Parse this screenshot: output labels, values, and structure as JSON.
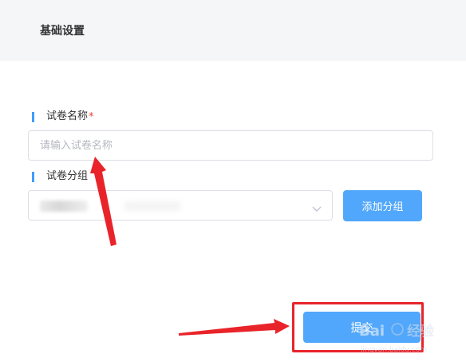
{
  "header": {
    "title": "基础设置"
  },
  "form": {
    "name_label": "试卷名称",
    "name_required_mark": "*",
    "name_placeholder": "请输入试卷名称",
    "name_value": "",
    "group_label": "试卷分组",
    "group_selected": "",
    "add_group_button": "添加分组",
    "submit_button": "提交"
  },
  "colors": {
    "accent": "#409eff",
    "button_bg": "#51a7fb",
    "header_bg": "#f5f6f8",
    "annotation_red": "#e8242a",
    "required": "#e8433a"
  },
  "icons": {
    "select_arrow": "chevron-down-icon"
  },
  "watermark": {
    "text": "Bai 经验",
    "subtext": "jingyan.baidu.com"
  }
}
